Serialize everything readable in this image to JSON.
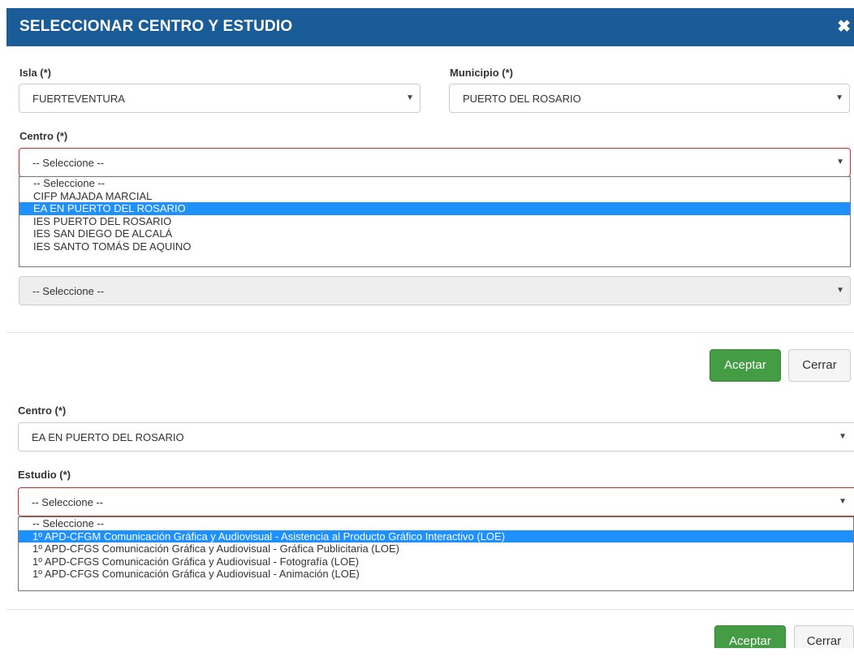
{
  "modal": {
    "title": "SELECCIONAR CENTRO Y ESTUDIO",
    "close_glyph": "✖"
  },
  "upper": {
    "isla_label": "Isla (*)",
    "isla_value": "FUERTEVENTURA",
    "municipio_label": "Municipio (*)",
    "municipio_value": "PUERTO DEL ROSARIO",
    "centro_label": "Centro (*)",
    "centro_value": "-- Seleccione --",
    "centro_options": [
      "-- Seleccione --",
      "CIFP MAJADA MARCIAL",
      "EA EN PUERTO DEL ROSARIO",
      "IES PUERTO DEL ROSARIO",
      "IES SAN DIEGO DE ALCALÁ",
      "IES SANTO TOMÁS DE AQUINO"
    ],
    "centro_highlighted_index": 2,
    "estudio_value": "-- Seleccione --",
    "accept_label": "Aceptar",
    "close_label": "Cerrar"
  },
  "lower": {
    "centro_label": "Centro (*)",
    "centro_value": "EA EN PUERTO DEL ROSARIO",
    "estudio_label": "Estudio (*)",
    "estudio_value": "-- Seleccione --",
    "estudio_options": [
      "-- Seleccione --",
      "1º APD-CFGM Comunicación Gráfica y Audiovisual - Asistencia al Producto Gráfico Interactivo (LOE)",
      "1º APD-CFGS Comunicación Gráfica y Audiovisual - Gráfica Publicitaria (LOE)",
      "1º APD-CFGS Comunicación Gráfica y Audiovisual - Fotografía (LOE)",
      "1º APD-CFGS Comunicación Gráfica y Audiovisual - Animación (LOE)"
    ],
    "estudio_highlighted_index": 1,
    "accept_label": "Aceptar",
    "close_label": "Cerrar"
  },
  "icons": {
    "dropdown_arrow": "▼"
  },
  "colors": {
    "header": "#1a5c98",
    "accept": "#449d44",
    "highlight": "#1e90ff",
    "invalid": "#c9302c"
  }
}
